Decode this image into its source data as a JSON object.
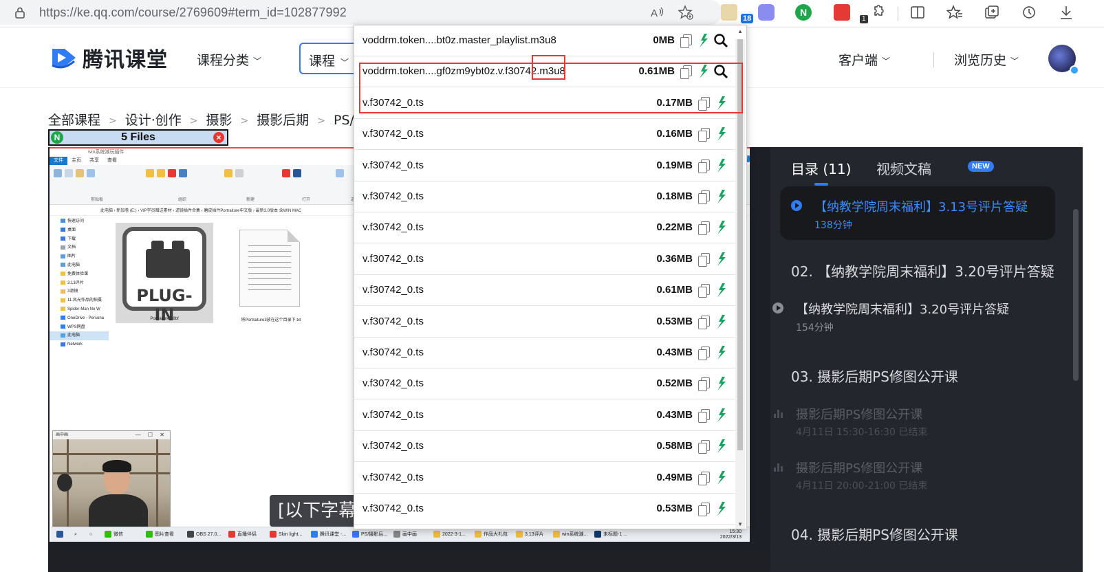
{
  "browser": {
    "url": "https://ke.qq.com/course/2769609#term_id=102877992",
    "extension_badge": "18",
    "extension_badge2": "1"
  },
  "header": {
    "logo_text": "腾讯课堂",
    "nav_category": "课程分类",
    "search_select": "课程",
    "client": "客户端",
    "history": "浏览历史"
  },
  "breadcrumb": [
    "全部课程",
    "设计·创作",
    "摄影",
    "摄影后期",
    "PS/摄影"
  ],
  "files_bar": {
    "label": "5 Files"
  },
  "downloader": {
    "rows": [
      {
        "name": "voddrm.token....bt0z.master_playlist.m3u8",
        "size": "0MB",
        "search": true
      },
      {
        "name": "voddrm.token....gf0zm9ybt0z.v.f30742.m3u8",
        "size": "0.61MB",
        "search": true
      },
      {
        "name": "v.f30742_0.ts",
        "size": "0.17MB"
      },
      {
        "name": "v.f30742_0.ts",
        "size": "0.16MB"
      },
      {
        "name": "v.f30742_0.ts",
        "size": "0.19MB"
      },
      {
        "name": "v.f30742_0.ts",
        "size": "0.18MB"
      },
      {
        "name": "v.f30742_0.ts",
        "size": "0.22MB"
      },
      {
        "name": "v.f30742_0.ts",
        "size": "0.36MB"
      },
      {
        "name": "v.f30742_0.ts",
        "size": "0.61MB"
      },
      {
        "name": "v.f30742_0.ts",
        "size": "0.53MB"
      },
      {
        "name": "v.f30742_0.ts",
        "size": "0.43MB"
      },
      {
        "name": "v.f30742_0.ts",
        "size": "0.52MB"
      },
      {
        "name": "v.f30742_0.ts",
        "size": "0.43MB"
      },
      {
        "name": "v.f30742_0.ts",
        "size": "0.58MB"
      },
      {
        "name": "v.f30742_0.ts",
        "size": "0.49MB"
      },
      {
        "name": "v.f30742_0.ts",
        "size": "0.53MB"
      }
    ]
  },
  "video": {
    "explorer": {
      "window_title": "win系统潮玩插件",
      "tabs": [
        "文件",
        "主页",
        "共享",
        "查看"
      ],
      "ribbon_groups": [
        "剪贴板",
        "组织",
        "新建",
        "打开",
        "选择"
      ],
      "path": "此电脑 › 新加卷 (E:) › VIP学员赠送素材 › 滤镜插件合集 › 磨皮插件Portraiture中文版 › 最新3.0版本 含WIN MAC",
      "nav_items": [
        "快速访问",
        "桌面",
        "下载",
        "文档",
        "图片",
        "此电脑",
        "免费体验课",
        "3.13评片",
        "3滤镜",
        "11.风光作品的拍摄",
        "Spider-Man No W",
        "OneDrive - Persona",
        "WPS网盘",
        "此电脑",
        "Network"
      ],
      "plugin_label": "PLUG-IN",
      "plugin_file": "Portraiture3.8bf",
      "txt_file": "将Portraiture3放在这个目录下.txt"
    },
    "webcam_title": "画中画",
    "taskbar": [
      "微信",
      "图片查看",
      "OBS 27.0...",
      "直播伴侣",
      "Skin light...",
      "腾讯课堂 -...",
      "PS/摄影后...",
      "画中画",
      "2022-3-1...",
      "作品大礼包",
      "3.13评片",
      "win系统潮...",
      "未标题-1 ..."
    ],
    "clock_time": "15:30",
    "clock_date": "2022/3/13",
    "subtitle": "[以下字幕"
  },
  "sidebar": {
    "tab_catalog": "目录 (11)",
    "tab_transcript": "视频文稿",
    "new_badge": "NEW",
    "active_lesson_title": "【纳教学院周末福利】3.13号评片答疑",
    "active_lesson_meta": "138分钟",
    "chapter2_title": "02. 【纳教学院周末福利】3.20号评片答疑",
    "chapter2_lesson_title": "【纳教学院周末福利】3.20号评片答疑",
    "chapter2_lesson_meta": "154分钟",
    "chapter3_title": "03. 摄影后期PS修图公开课",
    "chapter3_lesson1_title": "摄影后期PS修图公开课",
    "chapter3_lesson1_meta": "4月11日 15:30-16:30 已结束",
    "chapter3_lesson2_title": "摄影后期PS修图公开课",
    "chapter3_lesson2_meta": "4月11日 20:00-21:00 已结束",
    "chapter4_title": "04. 摄影后期PS修图公开课"
  },
  "colors": {
    "accent": "#2f7cf6",
    "highlight": "#e53935",
    "download_green": "#1aa260",
    "sidebar_bg": "#23262c"
  }
}
